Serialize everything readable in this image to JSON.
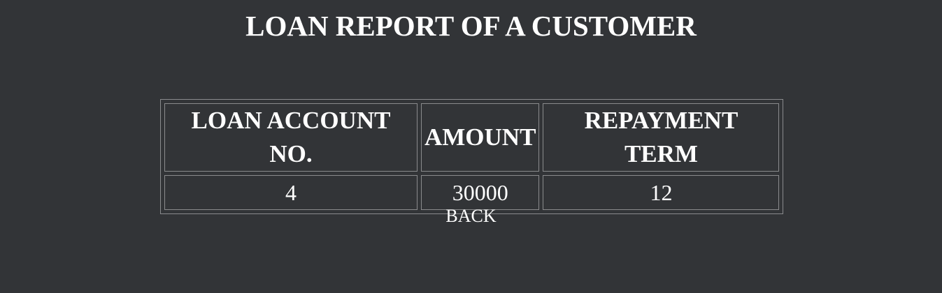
{
  "page": {
    "title": "LOAN REPORT OF A CUSTOMER",
    "background_color": "#323437",
    "text_color": "#ffffff",
    "border_color": "#8a8b8d"
  },
  "table": {
    "headers": {
      "loan_account_no": "LOAN ACCOUNT NO.",
      "amount": "AMOUNT",
      "repayment_term": "REPAYMENT TERM"
    },
    "rows": [
      {
        "loan_account_no": "4",
        "amount": "30000",
        "repayment_term": "12"
      }
    ]
  },
  "nav": {
    "back_label": "BACK"
  }
}
